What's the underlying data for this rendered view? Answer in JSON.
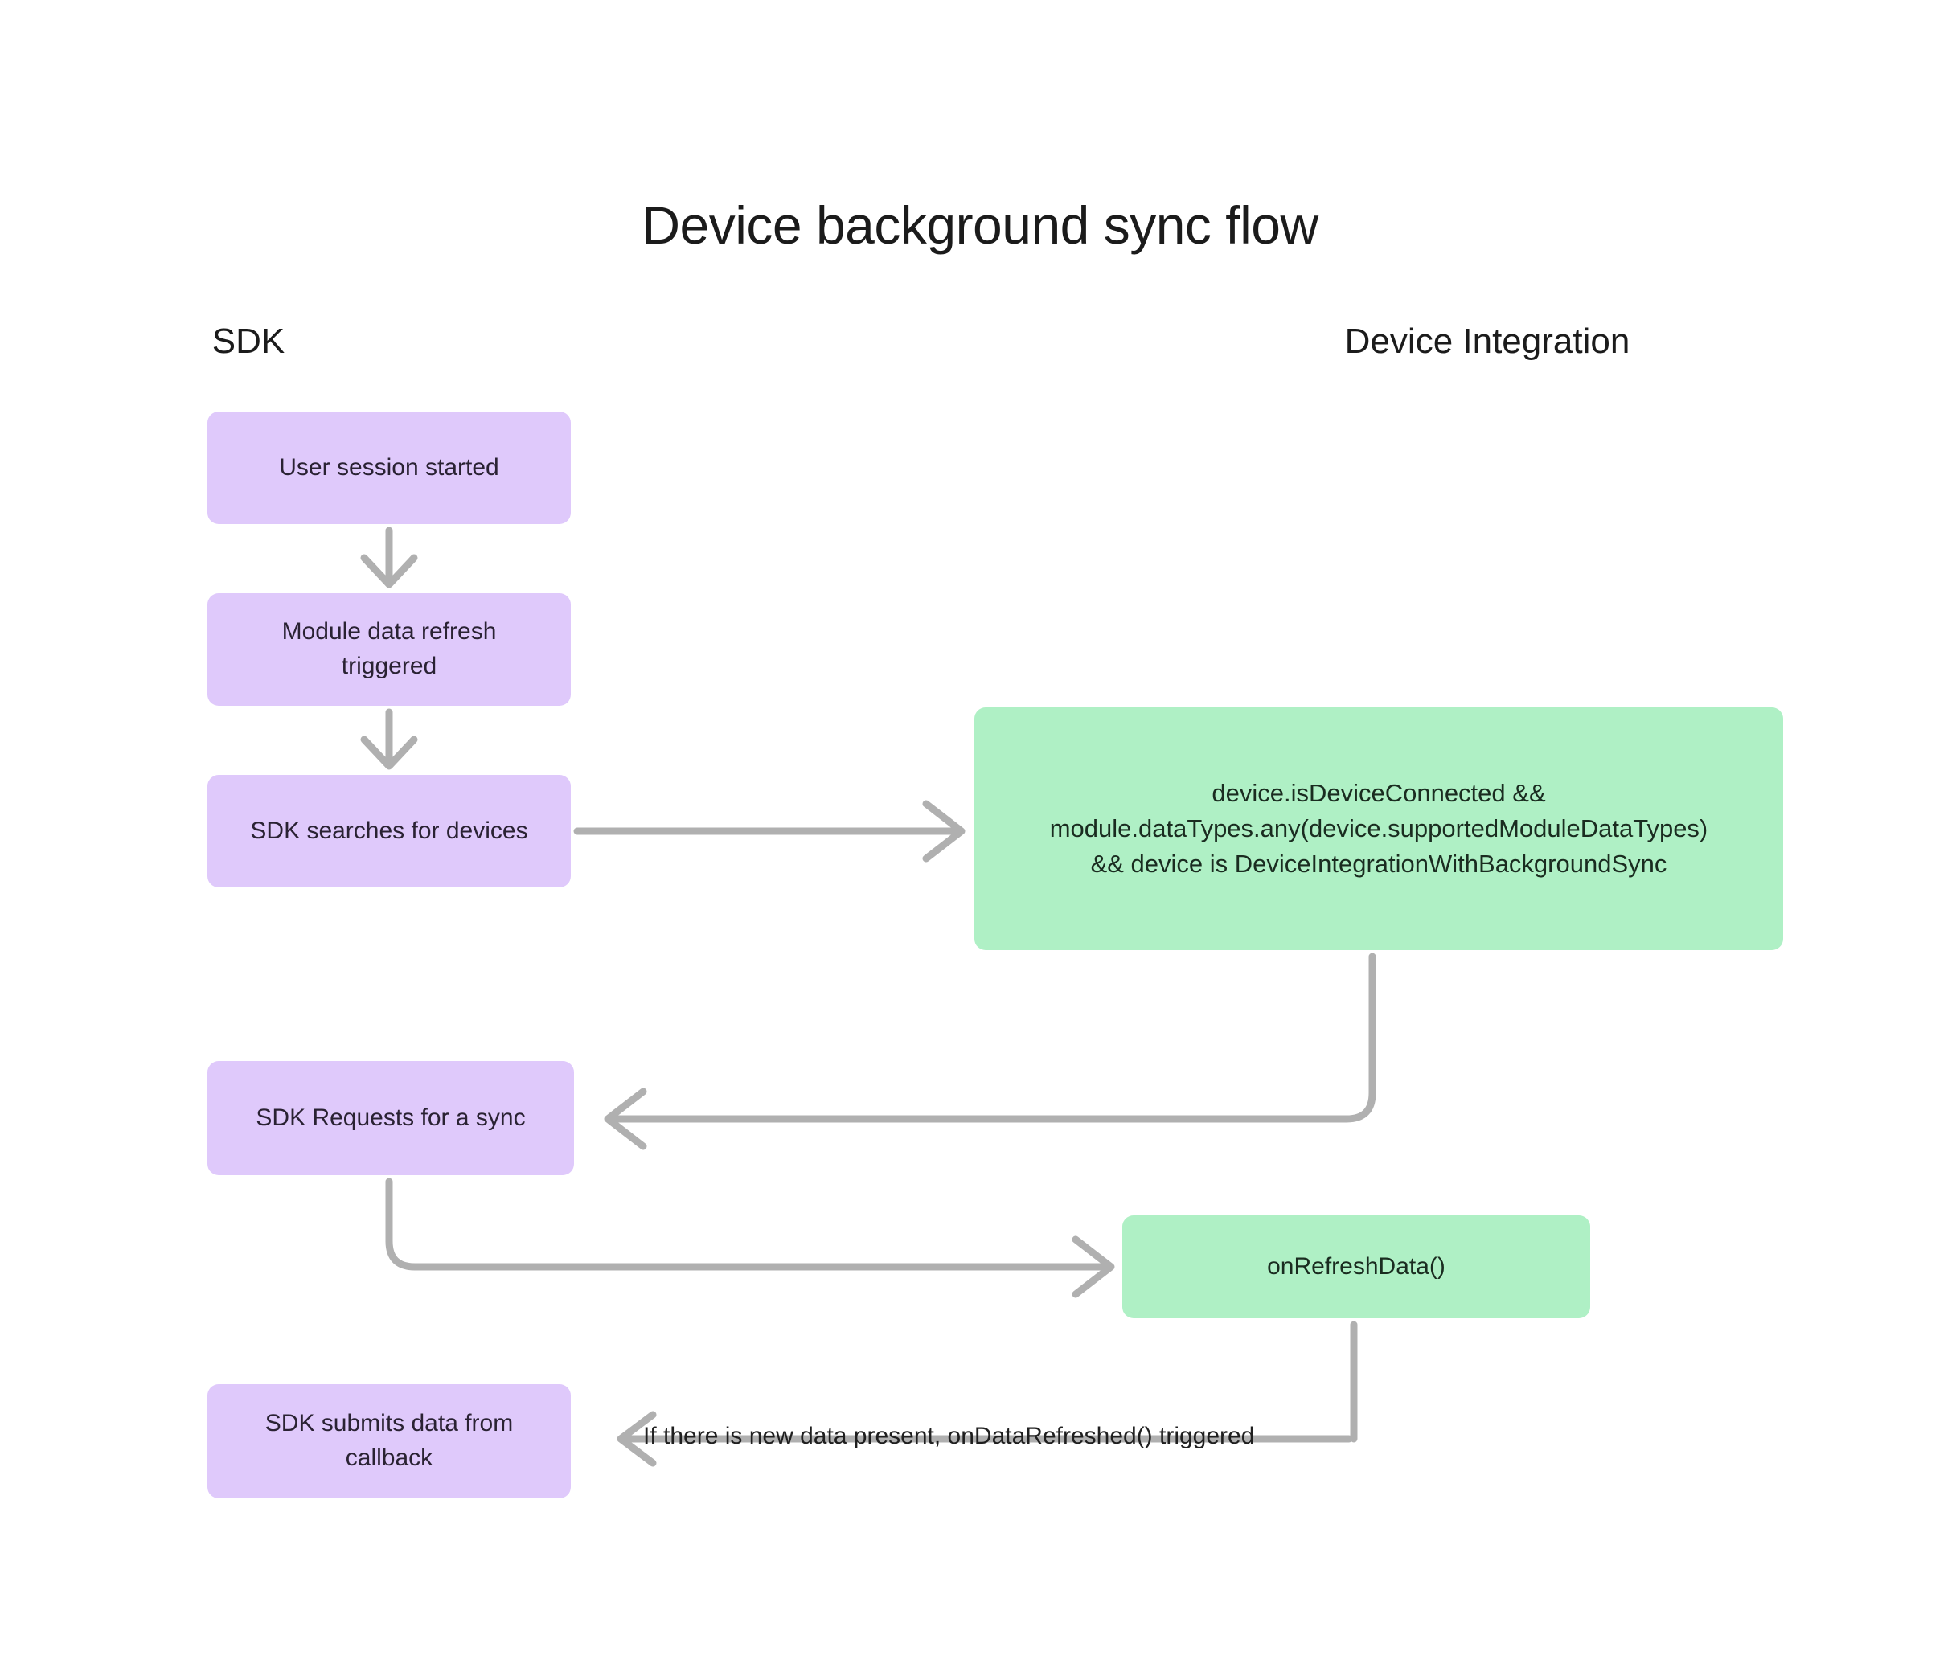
{
  "diagram": {
    "title": "Device background sync flow",
    "type": "flowchart",
    "background_color": "#ffffff",
    "colors": {
      "sdk_node_fill": "#dfc9fb",
      "sdk_node_text": "#2a2233",
      "device_node_fill": "#aff0c5",
      "device_node_text": "#1a2c20",
      "connector": "#b0b0b0",
      "title_text": "#1b1b1b"
    },
    "lanes": [
      {
        "id": "sdk",
        "label": "SDK"
      },
      {
        "id": "device-integration",
        "label": "Device Integration"
      }
    ],
    "nodes": [
      {
        "id": "user-session",
        "lane": "sdk",
        "label": "User session started",
        "color": "purple"
      },
      {
        "id": "module-refresh",
        "lane": "sdk",
        "label": "Module data refresh triggered",
        "color": "purple"
      },
      {
        "id": "sdk-searches",
        "lane": "sdk",
        "label": "SDK searches for devices",
        "color": "purple"
      },
      {
        "id": "sdk-requests",
        "lane": "sdk",
        "label": "SDK Requests for a sync",
        "color": "purple"
      },
      {
        "id": "sdk-submits",
        "lane": "sdk",
        "label": "SDK submits data from callback",
        "color": "purple"
      },
      {
        "id": "condition",
        "lane": "device-integration",
        "label": "device.isDeviceConnected && module.dataTypes.any(device.supportedModuleDataTypes) && device is DeviceIntegrationWithBackgroundSync",
        "color": "green",
        "lines": [
          "device.isDeviceConnected &&",
          "module.dataTypes.any(device.supportedModuleDataTypes)",
          "&& device is DeviceIntegrationWithBackgroundSync"
        ]
      },
      {
        "id": "on-refresh-data",
        "lane": "device-integration",
        "label": "onRefreshData()",
        "color": "green"
      }
    ],
    "node_labels": {
      "user_session": "User session started",
      "module_refresh_line1": "Module data refresh",
      "module_refresh_line2": "triggered",
      "sdk_searches": "SDK searches for devices",
      "sdk_requests": "SDK Requests for a sync",
      "sdk_submits_line1": "SDK submits data from",
      "sdk_submits_line2": "callback",
      "condition_line1": "device.isDeviceConnected &&",
      "condition_line2": "module.dataTypes.any(device.supportedModuleDataTypes)",
      "condition_line3": "&& device is DeviceIntegrationWithBackgroundSync",
      "on_refresh_data": "onRefreshData()"
    },
    "edges": [
      {
        "id": "e1",
        "from": "user-session",
        "to": "module-refresh",
        "label": "",
        "direction": "down"
      },
      {
        "id": "e2",
        "from": "module-refresh",
        "to": "sdk-searches",
        "label": "",
        "direction": "down"
      },
      {
        "id": "e3",
        "from": "sdk-searches",
        "to": "condition",
        "label": "",
        "direction": "right"
      },
      {
        "id": "e4",
        "from": "condition",
        "to": "sdk-requests",
        "label": "",
        "direction": "down-left"
      },
      {
        "id": "e5",
        "from": "sdk-requests",
        "to": "on-refresh-data",
        "label": "",
        "direction": "down-right"
      },
      {
        "id": "e6",
        "from": "on-refresh-data",
        "to": "sdk-submits",
        "label": "If there is new data present, onDataRefreshed() triggered",
        "direction": "down-left"
      }
    ],
    "edge_labels": {
      "on_data_refreshed": "If there is new data present, onDataRefreshed() triggered"
    }
  }
}
